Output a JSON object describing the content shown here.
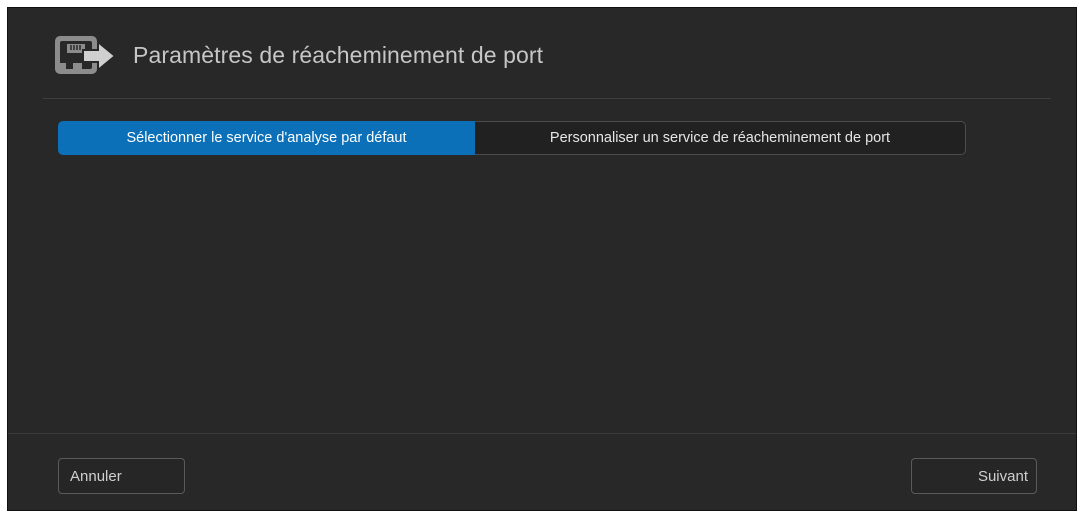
{
  "dialog": {
    "title": "Paramètres de réacheminement de port",
    "icon": "port-forwarding-icon"
  },
  "tabs": [
    {
      "label": "Sélectionner le service d'analyse par défaut",
      "active": true
    },
    {
      "label": "Personnaliser un service de réacheminement de port",
      "active": false
    }
  ],
  "footer": {
    "cancel_label": "Annuler",
    "next_label": "Suivant"
  },
  "colors": {
    "background": "#282828",
    "accent": "#0b70b8",
    "text": "#c6c6c6"
  }
}
